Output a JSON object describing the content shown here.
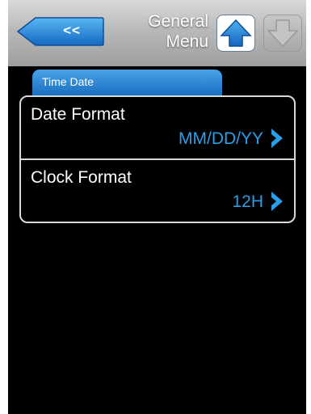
{
  "header": {
    "back_label": "<<",
    "title_line1": "General",
    "title_line2": "Menu",
    "scroll_up_icon": "arrow-up-icon",
    "scroll_down_icon": "arrow-down-icon"
  },
  "tab": {
    "label": "Time Date"
  },
  "settings": [
    {
      "label": "Date Format",
      "value": "MM/DD/YY"
    },
    {
      "label": "Clock Format",
      "value": "12H"
    }
  ],
  "colors": {
    "accent_blue": "#2a9ee8",
    "tab_blue": "#1a6fc0",
    "header_gray": "#b9b9b9",
    "background": "#000000"
  }
}
